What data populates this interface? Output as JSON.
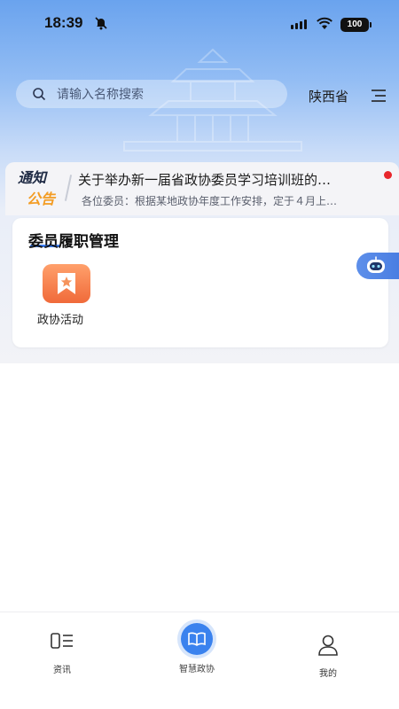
{
  "status_bar": {
    "time": "18:39",
    "battery": "100"
  },
  "header": {
    "search_placeholder": "请输入名称搜索",
    "region": "陕西省"
  },
  "notice": {
    "badge_top": "通知",
    "badge_bottom": "公告",
    "title": "关于举办新一届省政协委员学习培训班的…",
    "subtitle": "各位委员：根据某地政协年度工作安排，定于４月上…"
  },
  "card": {
    "title": "委员履职管理",
    "apps": [
      {
        "label": "政协活动"
      }
    ]
  },
  "bottom_nav": {
    "items": [
      {
        "label": "资讯"
      },
      {
        "label": "智慧政协"
      },
      {
        "label": "我的"
      }
    ]
  },
  "colors": {
    "accent": "#3a82ee",
    "notice_dot": "#e8262c",
    "app_orange": "#f06a3a",
    "badge_orange": "#f39c23"
  }
}
